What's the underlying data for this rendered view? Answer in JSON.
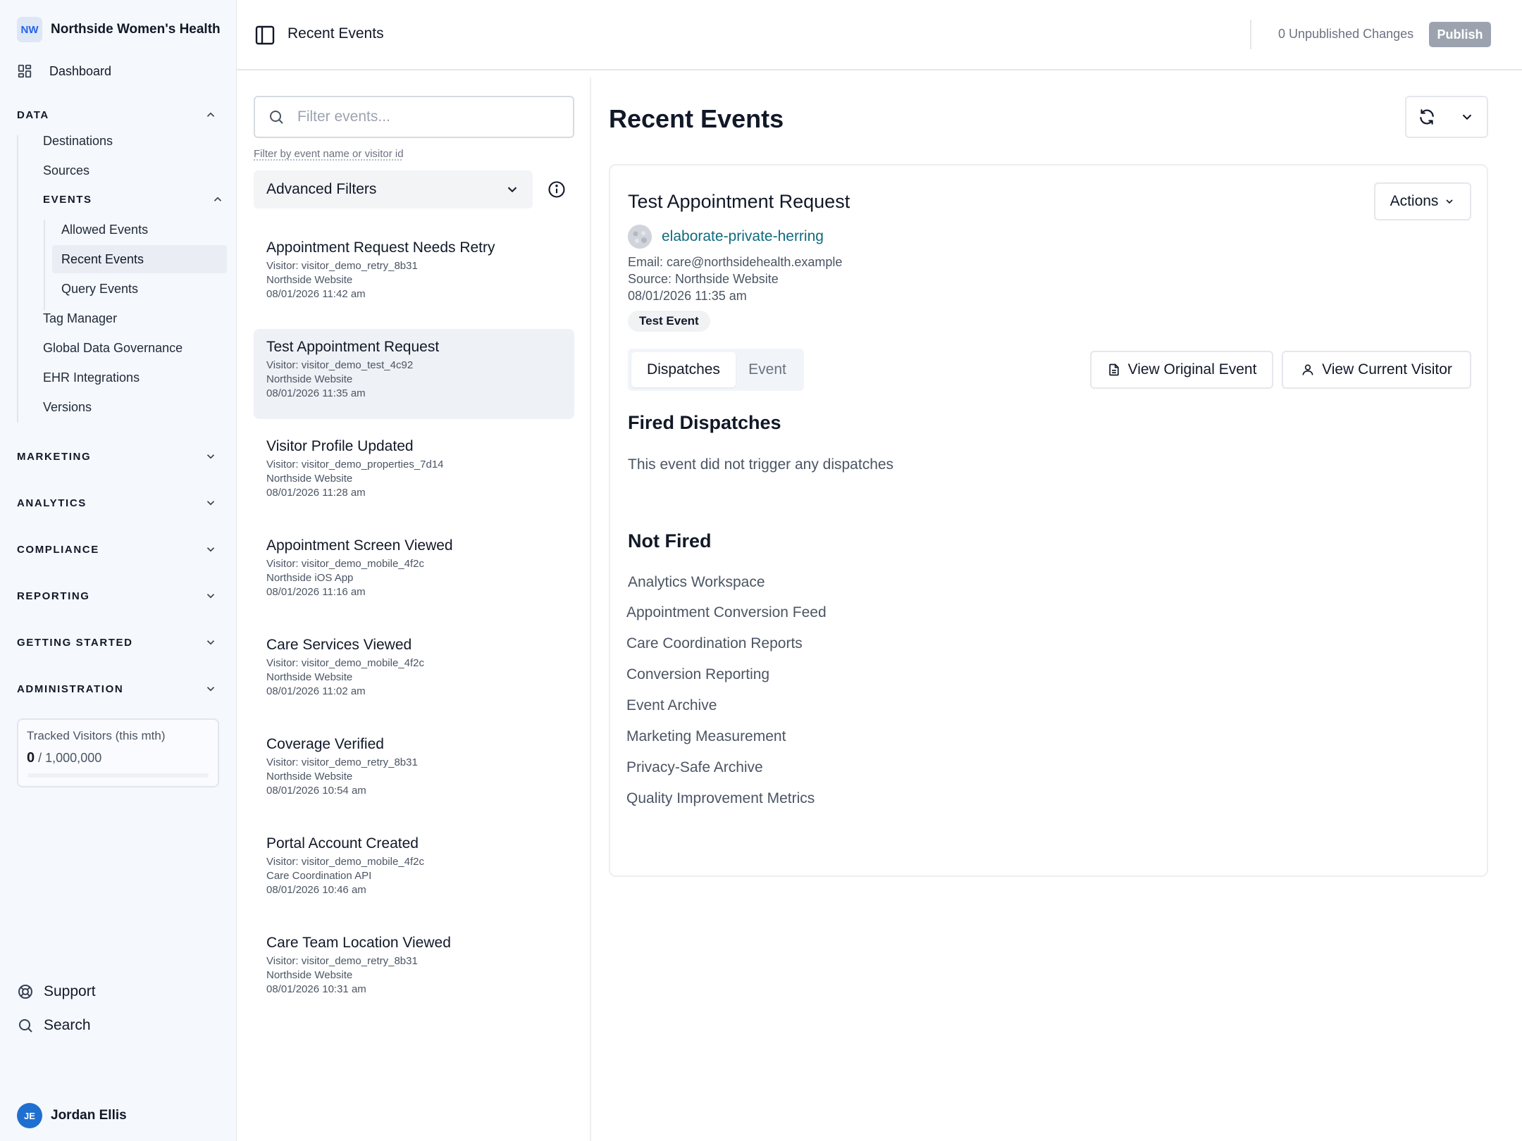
{
  "org": {
    "initials": "NW",
    "name": "Northside Women's Health"
  },
  "sidebar": {
    "dashboard": "Dashboard",
    "data_section": "DATA",
    "data_items": [
      "Destinations",
      "Sources"
    ],
    "events_section": "EVENTS",
    "event_items": [
      "Allowed Events",
      "Recent Events",
      "Query Events"
    ],
    "more_items": [
      "Tag Manager",
      "Global Data Governance",
      "EHR Integrations",
      "Versions"
    ],
    "sections": [
      "MARKETING",
      "ANALYTICS",
      "COMPLIANCE",
      "REPORTING",
      "GETTING STARTED",
      "ADMINISTRATION"
    ],
    "tracked": {
      "label": "Tracked Visitors (this mth)",
      "used": "0",
      "limit": "/ 1,000,000",
      "fraction": 0
    },
    "support": "Support",
    "search": "Search",
    "user": {
      "initials": "JE",
      "name": "Jordan Ellis"
    }
  },
  "topbar": {
    "title": "Recent Events",
    "unpublished": "0 Unpublished Changes",
    "publish": "Publish"
  },
  "list": {
    "search_placeholder": "Filter events...",
    "search_value": "",
    "hint": "Filter by event name or visitor id",
    "advanced_filters": "Advanced Filters",
    "events": [
      {
        "name": "Appointment Request Needs Retry",
        "visitor": "Visitor: visitor_demo_retry_8b31",
        "source": "Northside Website",
        "time": "08/01/2026 11:42 am"
      },
      {
        "name": "Test Appointment Request",
        "visitor": "Visitor: visitor_demo_test_4c92",
        "source": "Northside Website",
        "time": "08/01/2026 11:35 am"
      },
      {
        "name": "Visitor Profile Updated",
        "visitor": "Visitor: visitor_demo_properties_7d14",
        "source": "Northside Website",
        "time": "08/01/2026 11:28 am"
      },
      {
        "name": "Appointment Screen Viewed",
        "visitor": "Visitor: visitor_demo_mobile_4f2c",
        "source": "Northside iOS App",
        "time": "08/01/2026 11:16 am"
      },
      {
        "name": "Care Services Viewed",
        "visitor": "Visitor: visitor_demo_mobile_4f2c",
        "source": "Northside Website",
        "time": "08/01/2026 11:02 am"
      },
      {
        "name": "Coverage Verified",
        "visitor": "Visitor: visitor_demo_retry_8b31",
        "source": "Northside Website",
        "time": "08/01/2026 10:54 am"
      },
      {
        "name": "Portal Account Created",
        "visitor": "Visitor: visitor_demo_mobile_4f2c",
        "source": "Care Coordination API",
        "time": "08/01/2026 10:46 am"
      },
      {
        "name": "Care Team Location Viewed",
        "visitor": "Visitor: visitor_demo_retry_8b31",
        "source": "Northside Website",
        "time": "08/01/2026 10:31 am"
      }
    ]
  },
  "detail": {
    "page_title": "Recent Events",
    "event_title": "Test Appointment Request",
    "actions": "Actions",
    "visitor_name": "elaborate-private-herring",
    "email": "Email: care@northsidehealth.example",
    "source": "Source: Northside Website",
    "time": "08/01/2026 11:35 am",
    "badge": "Test Event",
    "tabs": [
      "Dispatches",
      "Event"
    ],
    "view_original": "View Original Event",
    "view_visitor": "View Current Visitor",
    "fired_title": "Fired Dispatches",
    "fired_empty": "This event did not trigger any dispatches",
    "not_fired_title": "Not Fired",
    "not_fired": [
      "Analytics Workspace",
      "Appointment Conversion Feed",
      "Care Coordination Reports",
      "Conversion Reporting",
      "Event Archive",
      "Marketing Measurement",
      "Privacy-Safe Archive",
      "Quality Improvement Metrics"
    ]
  },
  "colors": {
    "accent": "#2563eb",
    "link": "#0f6b7e",
    "publish_disabled": "#9ca3af"
  }
}
